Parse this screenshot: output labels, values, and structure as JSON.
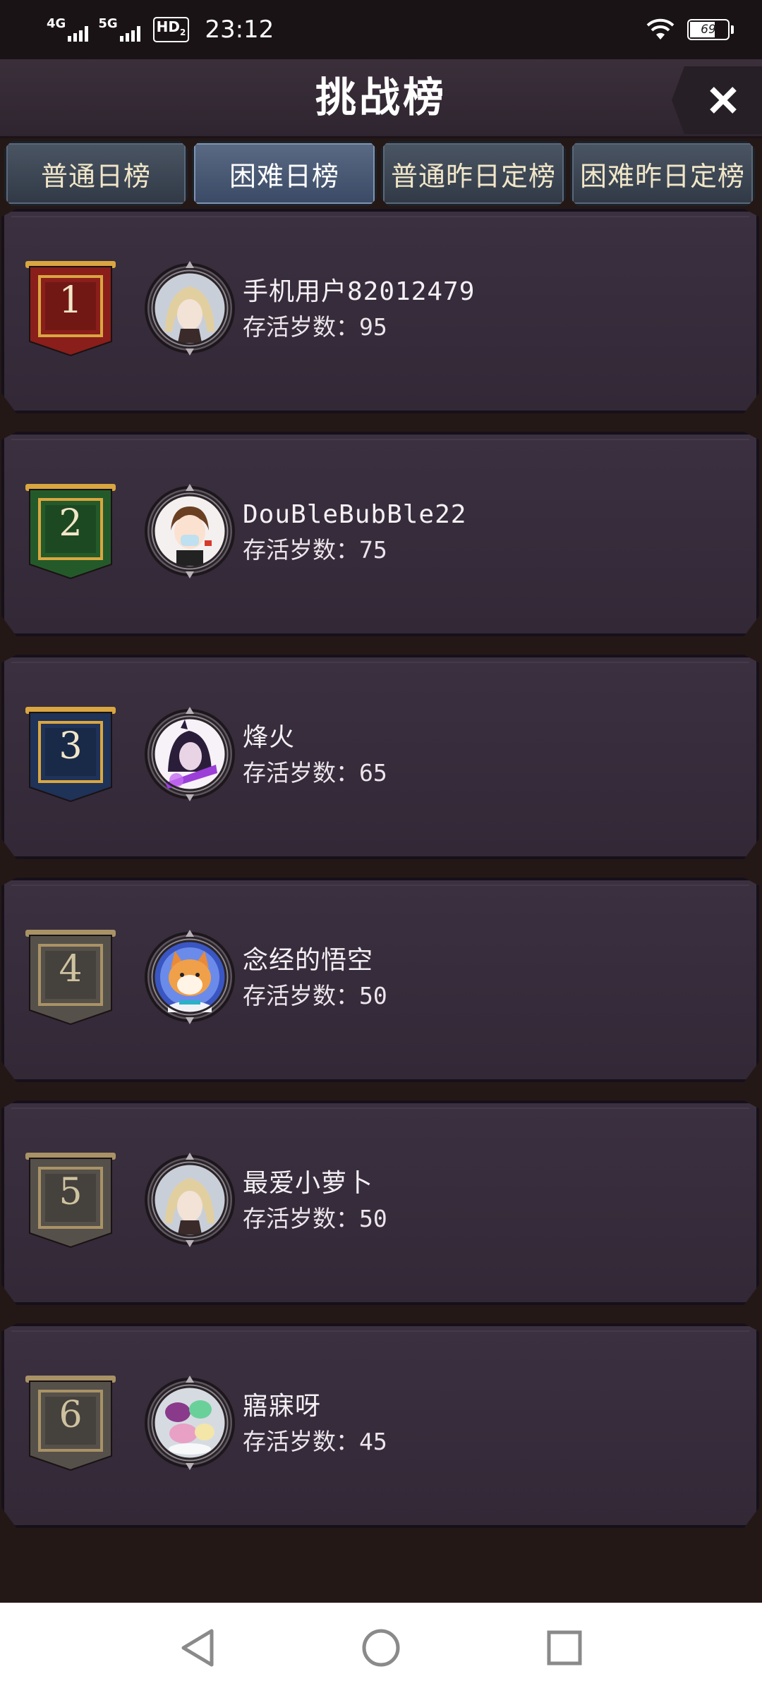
{
  "status_bar": {
    "network_1": "4G",
    "network_2": "5G",
    "hd": "HD",
    "hd_sub": "2",
    "time": "23:12",
    "battery_percent": 69
  },
  "header": {
    "title": "挑战榜",
    "close_icon": "close-icon"
  },
  "tabs": [
    {
      "label": "普通日榜",
      "active": false
    },
    {
      "label": "困难日榜",
      "active": true
    },
    {
      "label": "普通昨日定榜",
      "active": false
    },
    {
      "label": "困难昨日定榜",
      "active": false
    }
  ],
  "score_label": "存活岁数：",
  "entries": [
    {
      "rank": "1",
      "name": "手机用户82012479",
      "score": "95",
      "banner_color": "#8a1e1a",
      "avatar": "anime-girl-blonde"
    },
    {
      "rank": "2",
      "name": "DouBleBubBle22",
      "score": "75",
      "banner_color": "#245a2a",
      "avatar": "cartoon-boy-mask"
    },
    {
      "rank": "3",
      "name": "烽火",
      "score": "65",
      "banner_color": "#1f3258",
      "avatar": "anime-dark-purple"
    },
    {
      "rank": "4",
      "name": "念经的悟空",
      "score": "50",
      "banner_color": "#55504a",
      "avatar": "shiba-dog-astronaut"
    },
    {
      "rank": "5",
      "name": "最爱小萝卜",
      "score": "50",
      "banner_color": "#55504a",
      "avatar": "anime-girl-blonde"
    },
    {
      "rank": "6",
      "name": "寤寐呀",
      "score": "45",
      "banner_color": "#55504a",
      "avatar": "macarons-dessert"
    }
  ],
  "nav": {
    "back": "back-triangle-icon",
    "home": "home-circle-icon",
    "recents": "recents-square-icon"
  }
}
